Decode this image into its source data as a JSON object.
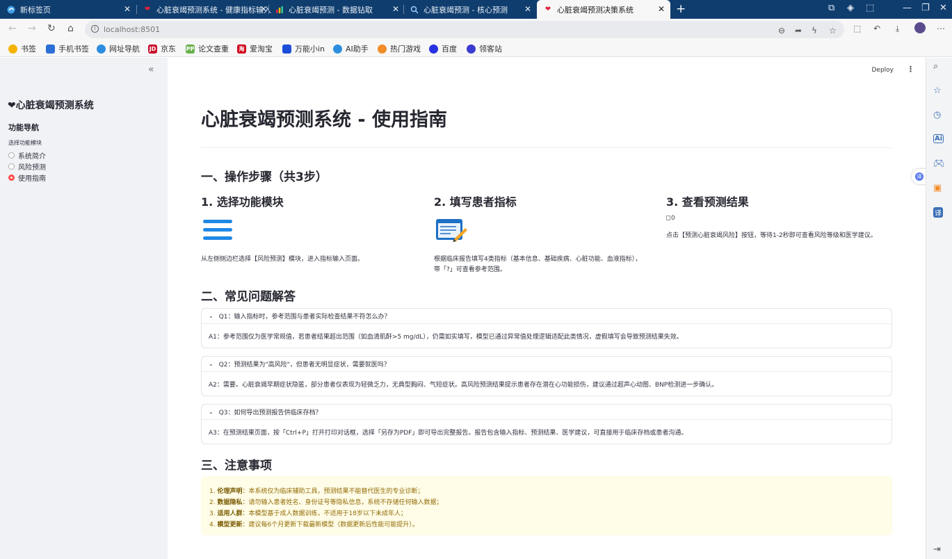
{
  "browser": {
    "tabs": [
      {
        "title": "新标签页",
        "icon": "edge-icon"
      },
      {
        "title": "心脏衰竭预测系统 - 健康指标输入",
        "icon": "heart-icon"
      },
      {
        "title": "心脏衰竭预测 - 数据钻取",
        "icon": "chart-icon"
      },
      {
        "title": "心脏衰竭预测 - 核心预测",
        "icon": "search-icon"
      },
      {
        "title": "心脏衰竭预测决策系统",
        "icon": "heart-icon"
      }
    ],
    "url": "localhost:8501",
    "bookmarks": [
      "书签",
      "手机书签",
      "网址导航",
      "京东",
      "论文查重",
      "爱淘宝",
      "万能小in",
      "AI助手",
      "热门游戏",
      "百度",
      "领客站"
    ]
  },
  "sidebar": {
    "title": "❤心脏衰竭预测系统",
    "nav_heading": "功能导航",
    "radio_label": "选择功能模块",
    "options": [
      "系统简介",
      "风险预测",
      "使用指南"
    ],
    "selected": "使用指南"
  },
  "header": {
    "deploy": "Deploy"
  },
  "main": {
    "title": "心脏衰竭预测系统 - 使用指南",
    "section1": "一、操作步骤（共3步）",
    "steps": [
      {
        "title": "1. 选择功能模块",
        "icon": "menu-lines-icon",
        "text": "从左侧侧边栏选择【风险预测】模块，进入指标输入页面。"
      },
      {
        "title": "2. 填写患者指标",
        "icon": "form-pencil-icon",
        "text": "根据临床报告填写4类指标（基本信息、基础疾病、心脏功能、血液指标），",
        "text2": "带「?」可查看参考范围。"
      },
      {
        "title": "3. 查看预测结果",
        "icon": "broken-image-icon",
        "alt": "0",
        "text": "点击【预测心脏衰竭风险】按钮，等待1-2秒即可查看风险等级和医学建议。"
      }
    ],
    "section2": "二、常见问题解答",
    "faq": [
      {
        "q": "Q1：输入指标时，参考范围与患者实际检查结果不符怎么办？",
        "a": "A1：参考范围仅为医学常规值，若患者结果超出范围（如血清肌酐>5 mg/dL），仍需如实填写，模型已通过异常值处理逻辑适配此类情况，虚假填写会导致预测结果失效。"
      },
      {
        "q": "Q2：预测结果为\"高风险\"，但患者无明显症状，需要就医吗？",
        "a": "A2：需要。心脏衰竭早期症状隐匿，部分患者仅表现为轻微乏力，无典型胸闷、气短症状。高风险预测结果提示患者存在潜在心功能损伤，建议通过超声心动图、BNP检测进一步确认。"
      },
      {
        "q": "Q3：如何导出预测报告供临床存档？",
        "a": "A3：在预测结果页面，按「Ctrl+P」打开打印对话框，选择「另存为PDF」即可导出完整报告。报告包含输入指标、预测结果、医学建议，可直接用于临床存档或患者沟通。"
      }
    ],
    "section3": "三、注意事项",
    "notices": [
      {
        "num": "1.",
        "bold": "伦理声明",
        "text": "：本系统仅为临床辅助工具，预测结果不能替代医生的专业诊断；"
      },
      {
        "num": "2.",
        "bold": "数据隐私",
        "text": "：请勿输入患者姓名、身份证号等隐私信息，系统不存储任何输入数据；"
      },
      {
        "num": "3.",
        "bold": "适用人群",
        "text": "：本模型基于成人数据训练，不适用于18岁以下未成年人；"
      },
      {
        "num": "4.",
        "bold": "模型更新",
        "text": "：建议每6个月更新下载最新模型（数据更新后性能可能提升）。"
      }
    ]
  },
  "colors": {
    "accent": "#ff4b4b",
    "sidebar_bg": "#f0f2f6",
    "tab_bar": "#0f3d6e",
    "notice_bg": "#fffce7",
    "notice_text": "#926c05"
  }
}
